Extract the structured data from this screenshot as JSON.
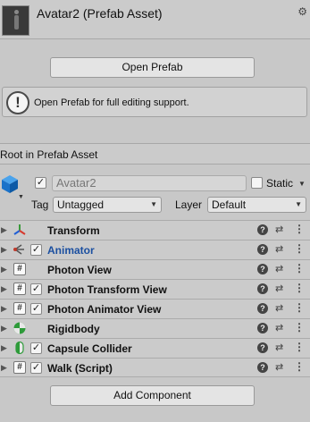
{
  "header": {
    "title": "Avatar2 (Prefab Asset)"
  },
  "open_prefab_label": "Open Prefab",
  "helpbox": {
    "icon": "!",
    "text": "Open Prefab for full editing support."
  },
  "root_header": "Root in Prefab Asset",
  "gameobject": {
    "active_check": "✓",
    "name": "Avatar2",
    "static_label": "Static",
    "tag_label": "Tag",
    "tag_value": "Untagged",
    "layer_label": "Layer",
    "layer_value": "Default"
  },
  "components": [
    {
      "name": "Transform",
      "icon": "transform-icon",
      "has_checkbox": false,
      "check": ""
    },
    {
      "name": "Animator",
      "icon": "animator-icon",
      "has_checkbox": true,
      "check": "✓"
    },
    {
      "name": "Photon View",
      "icon": "script-icon",
      "has_checkbox": false,
      "check": ""
    },
    {
      "name": "Photon Transform View",
      "icon": "script-icon",
      "has_checkbox": true,
      "check": "✓"
    },
    {
      "name": "Photon Animator View",
      "icon": "script-icon",
      "has_checkbox": true,
      "check": "✓"
    },
    {
      "name": "Rigidbody",
      "icon": "rigidbody-icon",
      "has_checkbox": false,
      "check": ""
    },
    {
      "name": "Capsule Collider",
      "icon": "capsule-collider-icon",
      "has_checkbox": true,
      "check": "✓"
    },
    {
      "name": "Walk (Script)",
      "icon": "script-icon",
      "has_checkbox": true,
      "check": "✓"
    }
  ],
  "icons": {
    "help": "?",
    "presets": "⇄",
    "menu": "⋮",
    "foldout": "▶",
    "gear": "⚙",
    "dropdown": "▼",
    "script_glyph": "#"
  },
  "add_component_label": "Add Component",
  "colors": {
    "panel_bg": "#c8c8c8",
    "button_bg": "#e4e4e4",
    "link_blue": "#1b4fa0",
    "rigidbody_green": "#2e9b3a",
    "go_icon_blue": "#1a72c9"
  }
}
